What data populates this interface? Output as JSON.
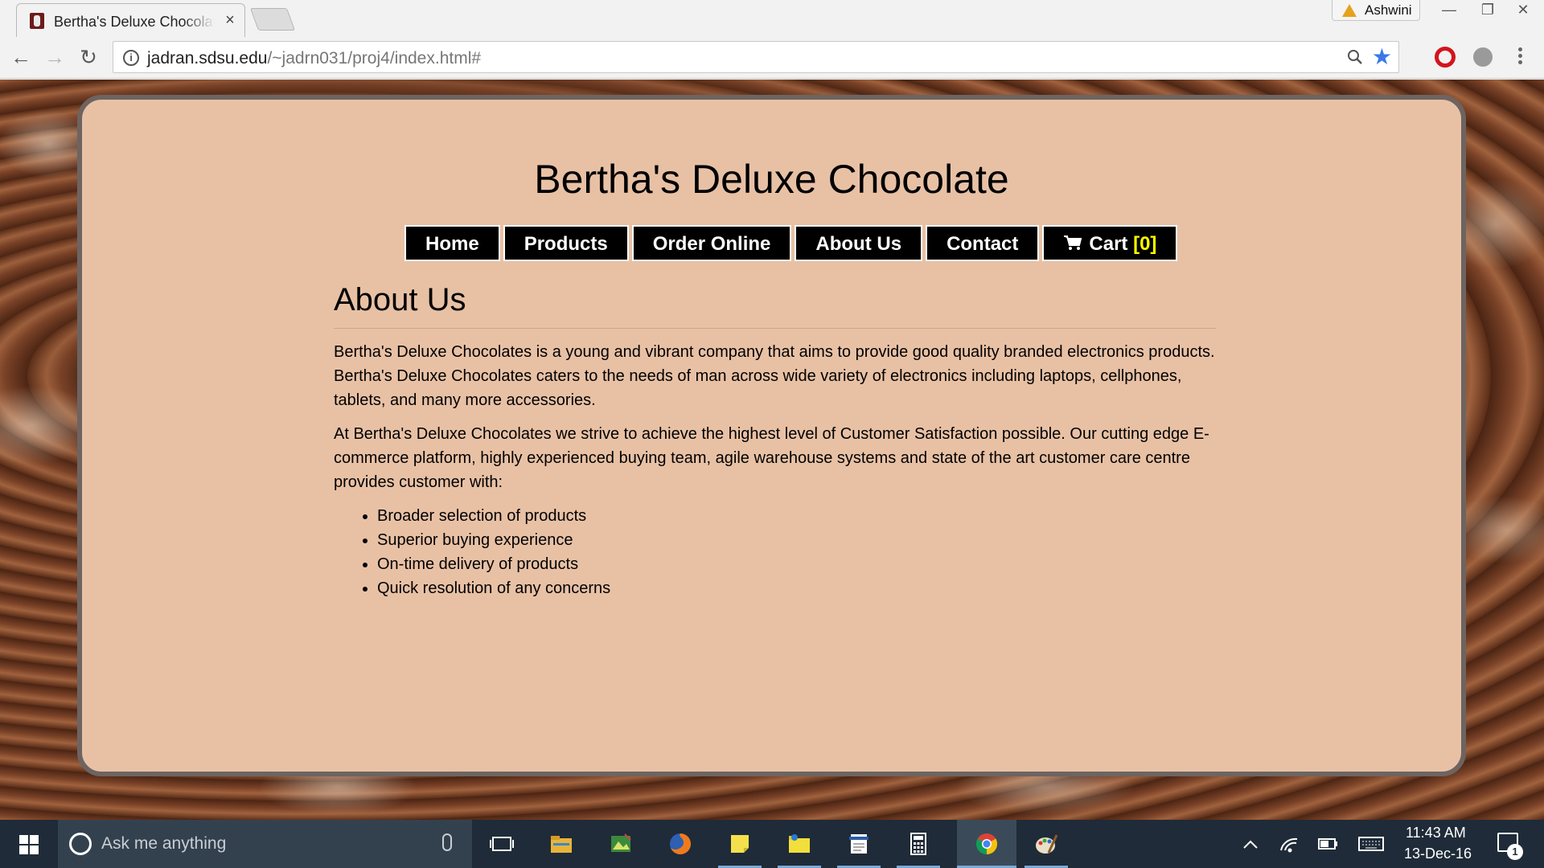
{
  "browser": {
    "tab_title": "Bertha's Deluxe Chocolat",
    "tab_close": "×",
    "profile_name": "Ashwini",
    "window_controls": {
      "minimize": "—",
      "restore": "❐",
      "close": "✕"
    },
    "back_glyph": "←",
    "forward_glyph": "→",
    "reload_glyph": "↻",
    "info_glyph": "i",
    "url_host": "jadran.sdsu.edu",
    "url_path": "/~jadrn031/proj4/index.html#",
    "star_glyph": "★"
  },
  "site": {
    "title": "Bertha's Deluxe Chocolate",
    "nav": {
      "home": "Home",
      "products": "Products",
      "order_online": "Order Online",
      "about_us": "About Us",
      "contact": "Contact",
      "cart_label": "Cart",
      "cart_count": "[0]"
    },
    "heading": "About Us",
    "paragraph_1": "Bertha's Deluxe Chocolates is a young and vibrant company that aims to provide good quality branded electronics products. Bertha's Deluxe Chocolates caters to the needs of man across wide variety of electronics including laptops, cellphones, tablets, and many more accessories.",
    "paragraph_2": "At Bertha's Deluxe Chocolates we strive to achieve the highest level of Customer Satisfaction possible. Our cutting edge E-commerce platform, highly experienced buying team, agile warehouse systems and state of the art customer care centre provides customer with:",
    "benefits": [
      "Broader selection of products",
      "Superior buying experience",
      "On-time delivery of products",
      "Quick resolution of any concerns"
    ]
  },
  "taskbar": {
    "search_placeholder": "Ask me anything",
    "apps": [
      "task-view-icon",
      "file-explorer-icon",
      "photo-app-icon",
      "firefox-icon",
      "sticky-notes-icon",
      "folder-app-icon",
      "document-app-icon",
      "calculator-icon",
      "chrome-icon",
      "paint-icon"
    ],
    "time": "11:43 AM",
    "date": "13-Dec-16",
    "notification_count": "1"
  },
  "colors": {
    "panel_bg": "#e8c1a5",
    "panel_border": "#6d6461",
    "nav_bg": "#000000",
    "cart_count": "#ffff00",
    "taskbar_bg": "#1f2b38"
  }
}
